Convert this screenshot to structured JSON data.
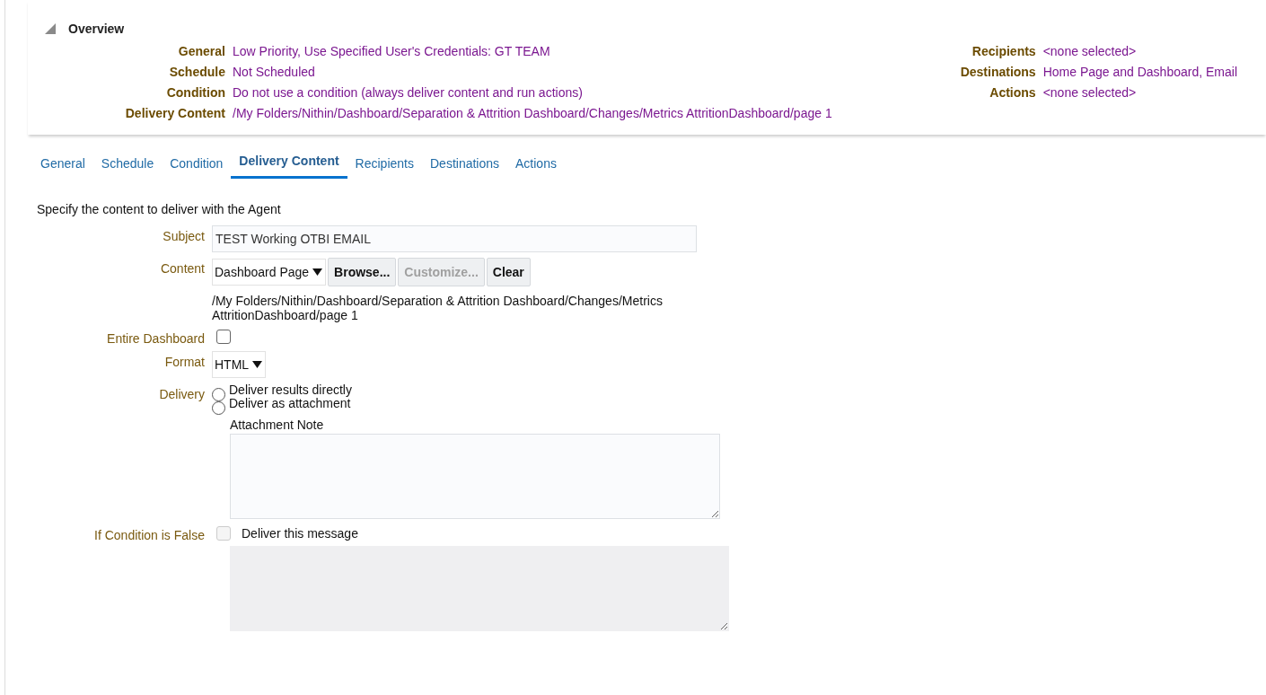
{
  "overview": {
    "title": "Overview",
    "expanded": true,
    "left": [
      {
        "label": "General",
        "value": "Low Priority, Use Specified User's Credentials: GT TEAM"
      },
      {
        "label": "Schedule",
        "value": "Not Scheduled"
      },
      {
        "label": "Condition",
        "value": "Do not use a condition (always deliver content and run actions)"
      },
      {
        "label": "Delivery Content",
        "value": "/My Folders/Nithin/Dashboard/Separation & Attrition Dashboard/Changes/Metrics AttritionDashboard/page 1"
      }
    ],
    "right": [
      {
        "label": "Recipients",
        "value": "<none selected>"
      },
      {
        "label": "Destinations",
        "value": "Home Page and Dashboard, Email"
      },
      {
        "label": "Actions",
        "value": "<none selected>"
      }
    ]
  },
  "tabs": [
    {
      "label": "General",
      "selected": false
    },
    {
      "label": "Schedule",
      "selected": false
    },
    {
      "label": "Condition",
      "selected": false
    },
    {
      "label": "Delivery Content",
      "selected": true
    },
    {
      "label": "Recipients",
      "selected": false
    },
    {
      "label": "Destinations",
      "selected": false
    },
    {
      "label": "Actions",
      "selected": false
    }
  ],
  "form": {
    "intro": "Specify the content to deliver with the Agent",
    "subject": {
      "label": "Subject",
      "value": "TEST Working OTBI EMAIL"
    },
    "content": {
      "label": "Content",
      "select_value": "Dashboard Page",
      "buttons": [
        {
          "label": "Browse...",
          "disabled": false
        },
        {
          "label": "Customize...",
          "disabled": true
        },
        {
          "label": "Clear",
          "disabled": false
        }
      ],
      "path": "/My Folders/Nithin/Dashboard/Separation & Attrition Dashboard/Changes/Metrics AttritionDashboard/page 1"
    },
    "entire_dashboard": {
      "label": "Entire Dashboard",
      "checked": false
    },
    "format": {
      "label": "Format",
      "value": "HTML"
    },
    "delivery": {
      "label": "Delivery",
      "options": [
        {
          "label": "Deliver results directly",
          "selected": false
        },
        {
          "label": "Deliver as attachment",
          "selected": false
        }
      ],
      "note_label": "Attachment Note"
    },
    "condition_false": {
      "label": "If Condition is False",
      "checked": false,
      "disabled": true,
      "option_label": "Deliver this message"
    }
  }
}
